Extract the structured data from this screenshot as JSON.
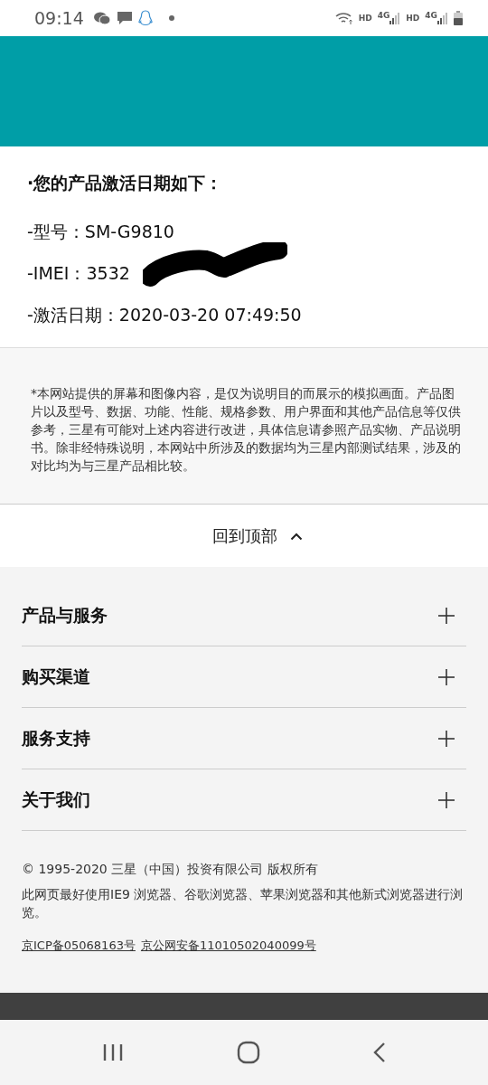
{
  "status_bar": {
    "time": "09:14",
    "network_labels": [
      "HD",
      "4G",
      "HD",
      "4G"
    ]
  },
  "activation": {
    "heading": "·您的产品激活日期如下：",
    "lines": [
      {
        "kind": "plain",
        "text": "-型号：SM-G9810"
      },
      {
        "kind": "redacted",
        "text": "-IMEI：3532"
      },
      {
        "kind": "plain",
        "text": "-激活日期：2020-03-20 07:49:50"
      }
    ]
  },
  "disclaimer": "*本网站提供的屏幕和图像内容，是仅为说明目的而展示的模拟画面。产品图片以及型号、数据、功能、性能、规格参数、用户界面和其他产品信息等仅供参考，三星有可能对上述内容进行改进，具体信息请参照产品实物、产品说明书。除非经特殊说明，本网站中所涉及的数据均为三星内部测试结果，涉及的对比均为与三星产品相比较。",
  "back_to_top": "回到顶部",
  "footer_sections": [
    {
      "label": "产品与服务",
      "expanded": false
    },
    {
      "label": "购买渠道",
      "expanded": false
    },
    {
      "label": "服务支持",
      "expanded": false
    },
    {
      "label": "关于我们",
      "expanded": false
    }
  ],
  "copyright": "© 1995-2020 三星（中国）投资有限公司 版权所有",
  "browser_note": "此网页最好使用IE9 浏览器、谷歌浏览器、苹果浏览器和其他新式浏览器进行浏览。",
  "licenses": [
    "京ICP备05068163号",
    "京公网安备11010502040099号"
  ]
}
